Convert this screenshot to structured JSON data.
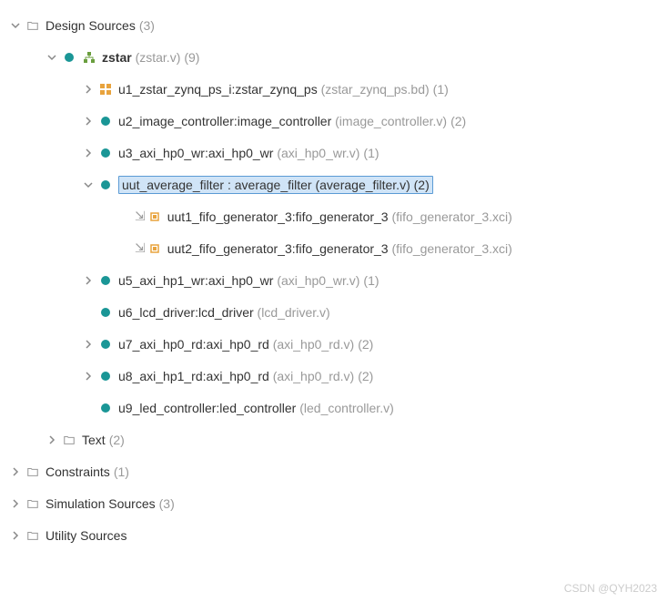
{
  "root": {
    "label": "Design Sources",
    "count": "(3)"
  },
  "zstar": {
    "label": "zstar",
    "file": "(zstar.v)",
    "count": "(9)"
  },
  "items": [
    {
      "inst": "u1_zstar_zynq_ps_i",
      "mod": "zstar_zynq_ps",
      "file": "(zstar_zynq_ps.bd)",
      "count": "(1)"
    },
    {
      "inst": "u2_image_controller",
      "mod": "image_controller",
      "file": "(image_controller.v)",
      "count": "(2)"
    },
    {
      "inst": "u3_axi_hp0_wr",
      "mod": "axi_hp0_wr",
      "file": "(axi_hp0_wr.v)",
      "count": "(1)"
    },
    {
      "inst": "uut_average_filter",
      "mod": "average_filter",
      "file": "(average_filter.v)",
      "count": "(2)"
    },
    {
      "inst": "u5_axi_hp1_wr",
      "mod": "axi_hp0_wr",
      "file": "(axi_hp0_wr.v)",
      "count": "(1)"
    },
    {
      "inst": "u6_lcd_driver",
      "mod": "lcd_driver",
      "file": "(lcd_driver.v)",
      "count": ""
    },
    {
      "inst": "u7_axi_hp0_rd",
      "mod": "axi_hp0_rd",
      "file": "(axi_hp0_rd.v)",
      "count": "(2)"
    },
    {
      "inst": "u8_axi_hp1_rd",
      "mod": "axi_hp0_rd",
      "file": "(axi_hp0_rd.v)",
      "count": "(2)"
    },
    {
      "inst": "u9_led_controller",
      "mod": "led_controller",
      "file": "(led_controller.v)",
      "count": ""
    }
  ],
  "fifo": [
    {
      "inst": "uut1_fifo_generator_3",
      "mod": "fifo_generator_3",
      "file": "(fifo_generator_3.xci)"
    },
    {
      "inst": "uut2_fifo_generator_3",
      "mod": "fifo_generator_3",
      "file": "(fifo_generator_3.xci)"
    }
  ],
  "text": {
    "label": "Text",
    "count": "(2)"
  },
  "constraints": {
    "label": "Constraints",
    "count": "(1)"
  },
  "sim": {
    "label": "Simulation Sources",
    "count": "(3)"
  },
  "util": {
    "label": "Utility Sources"
  },
  "sep": " : ",
  "watermark": "CSDN @QYH2023"
}
